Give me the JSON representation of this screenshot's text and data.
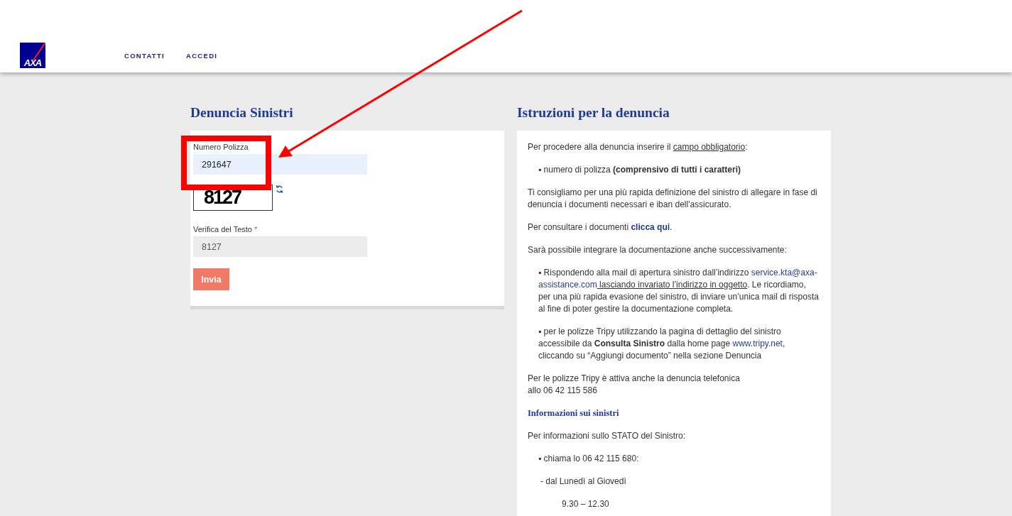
{
  "header": {
    "logo": "AXA",
    "nav": [
      {
        "label": "CONTATTI"
      },
      {
        "label": "ACCEDI"
      }
    ]
  },
  "form": {
    "title": "Denuncia Sinistri",
    "policy_field": {
      "label": "Numero Polizza",
      "value": "291647",
      "autofilled": true
    },
    "captcha": {
      "text": "8127"
    },
    "verify_field": {
      "label": "Verifica del Testo",
      "required": true,
      "required_mark": "*",
      "value": "8127"
    },
    "submit": "Invia"
  },
  "instructions": {
    "title": "Istruzioni per la denuncia",
    "blocks": [
      {
        "kind": "para",
        "parts": [
          {
            "kind": "plain",
            "text": "Per procedere alla denuncia inserire il "
          },
          {
            "kind": "underline",
            "text": "campo obbligatorio"
          },
          {
            "kind": "plain",
            "text": ":"
          }
        ]
      },
      {
        "kind": "bullet",
        "parts": [
          {
            "kind": "plain",
            "text": "▪ numero di polizza "
          },
          {
            "kind": "bold",
            "text": "(comprensivo di tutti i caratteri)"
          }
        ]
      },
      {
        "kind": "para",
        "parts": [
          {
            "kind": "plain",
            "text": "Ti consigliamo per una più rapida definizione del sinistro di allegare in fase di denuncia i documenti necessari e iban dell'assicurato."
          }
        ]
      },
      {
        "kind": "para",
        "parts": [
          {
            "kind": "plain",
            "text": "Per consultare i documenti "
          },
          {
            "kind": "link",
            "text": "clicca qui"
          },
          {
            "kind": "plain",
            "text": "."
          }
        ]
      },
      {
        "kind": "para",
        "parts": [
          {
            "kind": "plain",
            "text": "Sarà possibile integrare la documentazione anche successivamente:"
          }
        ]
      },
      {
        "kind": "bullet",
        "parts": [
          {
            "kind": "plain",
            "text": "▪ Rispondendo alla mail di apertura sinistro dall’indirizzo "
          },
          {
            "kind": "email",
            "text": "service.kta@axa-assistance.com"
          },
          {
            "kind": "underline",
            "text": " lasciando invariato l’indirizzo in oggetto"
          },
          {
            "kind": "plain",
            "text": ". Le ricordiamo, per una più rapida evasione del sinistro, di inviare un’unica mail di risposta al fine di poter gestire la documentazione completa."
          }
        ]
      },
      {
        "kind": "bullet",
        "parts": [
          {
            "kind": "plain",
            "text": "▪ per le polizze Tripy utilizzando la pagina di dettaglio del sinistro accessibile da "
          },
          {
            "kind": "bold",
            "text": "Consulta Sinistro"
          },
          {
            "kind": "plain",
            "text": " dalla home page "
          },
          {
            "kind": "email",
            "text": "www.tripy.net"
          },
          {
            "kind": "plain",
            "text": ", cliccando su “Aggiungi documento” nella sezione Denuncia"
          }
        ]
      },
      {
        "kind": "para",
        "parts": [
          {
            "kind": "plain",
            "text": "Per le polizze Tripy è attiva anche la denuncia telefonica\nallo 06 42 115 586"
          }
        ]
      },
      {
        "kind": "heading",
        "parts": [
          {
            "kind": "plain",
            "text": "Informazioni sui sinistri"
          }
        ]
      },
      {
        "kind": "para",
        "parts": [
          {
            "kind": "plain",
            "text": "Per informazioni sullo STATO del Sinistro:"
          }
        ]
      },
      {
        "kind": "bullet",
        "parts": [
          {
            "kind": "plain",
            "text": "▪ chiama lo 06 42 115 680:"
          }
        ]
      },
      {
        "kind": "sub",
        "parts": [
          {
            "kind": "plain",
            "text": "- dal Lunedì al Giovedì"
          }
        ]
      },
      {
        "kind": "time",
        "parts": [
          {
            "kind": "plain",
            "text": "9.30 – 12.30"
          }
        ]
      }
    ]
  },
  "annotation": {
    "highlight": true,
    "arrow": true
  }
}
